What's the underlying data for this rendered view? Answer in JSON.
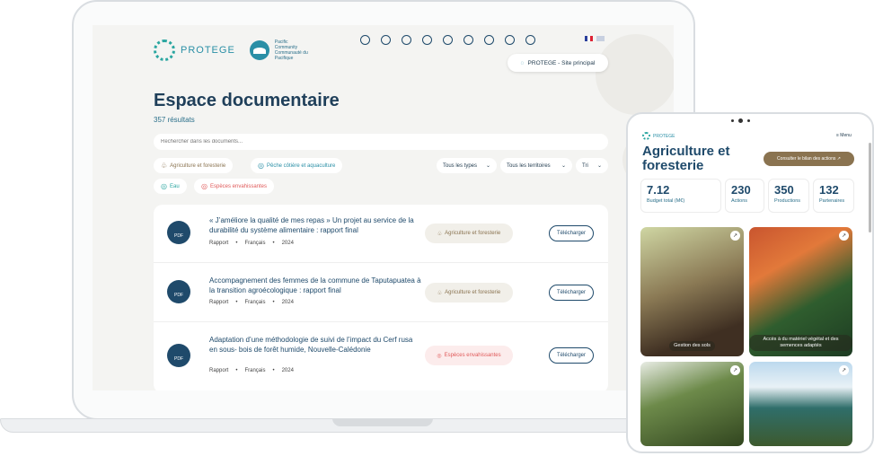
{
  "laptop": {
    "logo": {
      "name": "PROTEGE",
      "sub": "Pacific Community Communauté du Pacifique"
    },
    "partners": [
      "partner-1",
      "partner-2",
      "partner-3",
      "partner-4",
      "partner-5",
      "partner-6",
      "partner-7",
      "partner-8",
      "partner-9"
    ],
    "site_button": "PROTEGE - Site principal",
    "title": "Espace documentaire",
    "count": "357 résultats",
    "search_placeholder": "Rechercher dans les documents...",
    "chips": [
      {
        "label": "Agriculture et foresterie",
        "color": "#8a7350"
      },
      {
        "label": "Pêche côtière et aquaculture",
        "color": "#2a8fa6"
      },
      {
        "label": "Eau",
        "color": "#2aa6a0"
      },
      {
        "label": "Espèces envahissantes",
        "color": "#e05a5a"
      }
    ],
    "selects": [
      "Tous les types",
      "Tous les territoires",
      "Tri"
    ],
    "documents": [
      {
        "title": "« J’améliore la qualité de mes repas » Un projet au service de la durabilité du système alimentaire : rapport final",
        "type": "Rapport",
        "lang": "Français",
        "year": "2024",
        "tag": "Agriculture et foresterie",
        "action": "Télécharger"
      },
      {
        "title": "Accompagnement des femmes de la commune de Taputapuatea à la transition agroécologique : rapport final",
        "type": "Rapport",
        "lang": "Français",
        "year": "2024",
        "tag": "Agriculture et foresterie",
        "action": "Télécharger"
      },
      {
        "title": "Adaptation d’une méthodologie de suivi de l’impact du Cerf rusa en sous- bois de forêt humide, Nouvelle-Calédonie",
        "type": "Rapport",
        "lang": "Français",
        "year": "2024",
        "tag": "Espèces envahissantes",
        "action": "Télécharger"
      }
    ],
    "pdf_label": "PDF"
  },
  "tablet": {
    "logo": "PROTEGE",
    "menu": "≡ Menu",
    "title": "Agriculture et foresterie",
    "bilan_button": "Consulter le bilan des actions ↗",
    "stats": [
      {
        "value": "7.12",
        "label": "Budget total (M€)"
      },
      {
        "value": "230",
        "label": "Actions"
      },
      {
        "value": "350",
        "label": "Productions"
      },
      {
        "value": "132",
        "label": "Partenaires"
      }
    ],
    "cards": [
      {
        "label": "Gestion des sols"
      },
      {
        "label": "Accès à du matériel végétal et des semences adaptés"
      },
      {
        "label": ""
      },
      {
        "label": ""
      }
    ]
  }
}
